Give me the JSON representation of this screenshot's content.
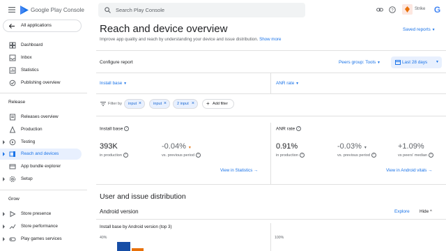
{
  "topbar": {
    "app_name": "Google Play Console",
    "search_placeholder": "Search Play Console",
    "user_label": "Strike"
  },
  "sidebar": {
    "all_apps": "All applications",
    "items_top": [
      {
        "label": "Dashboard",
        "icon": "dashboard-icon"
      },
      {
        "label": "Inbox",
        "icon": "inbox-icon"
      },
      {
        "label": "Statistics",
        "icon": "statistics-icon"
      },
      {
        "label": "Publishing overview",
        "icon": "publishing-icon"
      }
    ],
    "release_header": "Release",
    "release_items": [
      {
        "label": "Releases overview",
        "icon": "releases-icon"
      },
      {
        "label": "Production",
        "icon": "production-icon"
      },
      {
        "label": "Testing",
        "icon": "testing-icon"
      },
      {
        "label": "Reach and devices",
        "icon": "reach-icon"
      },
      {
        "label": "App bundle explorer",
        "icon": "bundle-icon"
      },
      {
        "label": "Setup",
        "icon": "setup-icon"
      }
    ],
    "grow_header": "Grow",
    "grow_items": [
      {
        "label": "Store presence",
        "icon": "store-presence-icon"
      },
      {
        "label": "Store performance",
        "icon": "store-performance-icon"
      },
      {
        "label": "Play games services",
        "icon": "games-icon"
      }
    ]
  },
  "main": {
    "title": "Reach and device overview",
    "subtitle": "Improve app quality and reach by understanding your device and issue distribution.",
    "show_more": "Show more",
    "saved_reports": "Saved reports",
    "configure_report": "Configure report",
    "peers_group": "Peers group: Tools",
    "date_range": "Last 28 days",
    "metric_left_select": "Install base",
    "metric_right_select": "ANR rate",
    "filter_by": "Filter by",
    "filters": [
      "input",
      "input",
      "2 input"
    ],
    "add_filter": "Add filter",
    "install_base": {
      "label": "Install base",
      "value": "393K",
      "value_sub": "in production",
      "change": "-0.04%",
      "change_sub": "vs. previous period",
      "link": "View in Statistics"
    },
    "anr": {
      "label": "ANR rate",
      "value": "0.91%",
      "value_sub": "in production",
      "change": "-0.03%",
      "change_sub": "vs. previous period",
      "peers": "+1.09%",
      "peers_sub": "vs peers' median",
      "link": "View in Android vitals"
    },
    "section_title": "User and issue distribution",
    "android_version": "Android version",
    "explore": "Explore",
    "hide": "Hide",
    "chart_title": "Install base by Android version (top 3)",
    "chart_left_tick": "40%",
    "chart_right_tick": "100%"
  },
  "colors": {
    "accent": "#1a73e8",
    "active_bg": "#e8f0fe",
    "bar_primary": "#174ea6",
    "bar_secondary": "#e8710a"
  }
}
